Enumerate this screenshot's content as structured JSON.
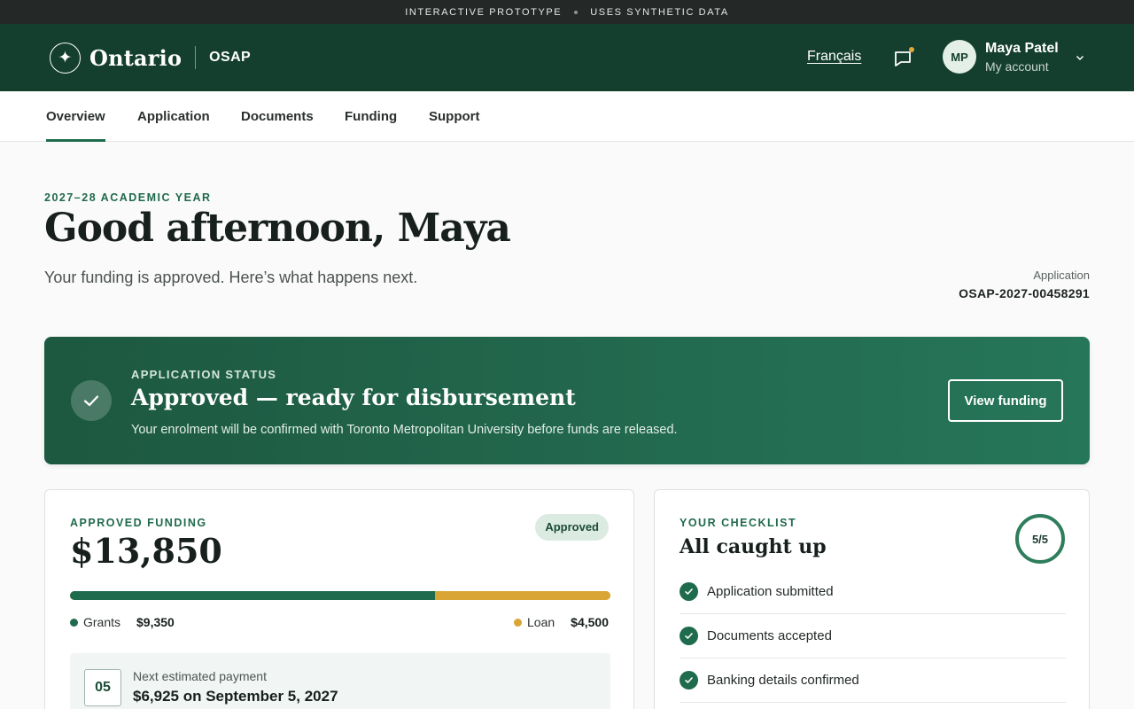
{
  "prototype_bar": {
    "left": "INTERACTIVE PROTOTYPE",
    "right": "USES SYNTHETIC DATA"
  },
  "header": {
    "brand": "Ontario",
    "program": "OSAP",
    "language_link": "Français",
    "messages_icon": "chat-bubble-icon",
    "messages_unread": true,
    "user": {
      "initials": "MP",
      "name": "Maya Patel",
      "sub": "My account"
    },
    "colors": {
      "header_bg": "#143f2e",
      "accent": "#1d6b4d",
      "notification": "#e0a93a"
    }
  },
  "nav": {
    "tabs": [
      {
        "label": "Overview",
        "active": true
      },
      {
        "label": "Application",
        "active": false
      },
      {
        "label": "Documents",
        "active": false
      },
      {
        "label": "Funding",
        "active": false
      },
      {
        "label": "Support",
        "active": false
      }
    ]
  },
  "greeting": {
    "eyebrow": "2027–28 ACADEMIC YEAR",
    "title": "Good afternoon, Maya",
    "subtitle": "Your funding is approved. Here’s what happens next.",
    "application_label": "Application",
    "application_number": "OSAP-2027-00458291"
  },
  "status_banner": {
    "eyebrow": "APPLICATION STATUS",
    "title": "Approved — ready for disbursement",
    "description": "Your enrolment will be confirmed with Toronto Metropolitan University before funds are released.",
    "button": "View funding"
  },
  "funding": {
    "eyebrow": "APPROVED FUNDING",
    "total": "$13,850",
    "badge": "Approved",
    "grants_label": "Grants",
    "grants_value": "$9,350",
    "grants_share": 0.675,
    "loan_label": "Loan",
    "loan_value": "$4,500",
    "loan_share": 0.325,
    "colors": {
      "grants": "#1e6b4d",
      "loan": "#d9a535"
    },
    "next_payment": {
      "day": "05",
      "label": "Next estimated payment",
      "value": "$6,925 on September 5, 2027"
    }
  },
  "checklist": {
    "eyebrow": "YOUR CHECKLIST",
    "title": "All caught up",
    "progress": "5/5",
    "items": [
      {
        "label": "Application submitted"
      },
      {
        "label": "Documents accepted"
      },
      {
        "label": "Banking details confirmed"
      }
    ]
  }
}
